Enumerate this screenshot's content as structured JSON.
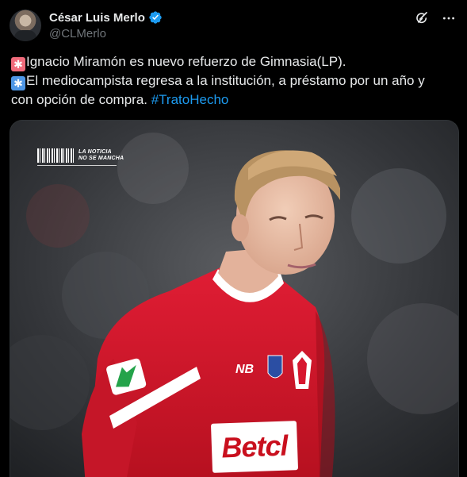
{
  "author": {
    "display_name": "César Luis Merlo",
    "handle": "@CLMerlo",
    "verified": true
  },
  "header_icons": [
    "grok-icon",
    "more-icon"
  ],
  "tweet": {
    "line1": {
      "emoji": "🚨",
      "text": "Ignacio Miramón es nuevo refuerzo de Gimnasia(LP)."
    },
    "line2": {
      "emoji": "✳️",
      "text": "El mediocampista regresa a la institución, a préstamo por un año y"
    },
    "line3": {
      "text": "con opción de compra. ",
      "hashtag": "#TratoHecho"
    }
  },
  "media": {
    "watermark_line1": "LA NOTICIA",
    "watermark_line2": "NO SE MANCHA",
    "sponsor_text": "Betcl"
  },
  "colors": {
    "background": "#000000",
    "text": "#e7e9ea",
    "secondary": "#71767b",
    "link": "#1d9bf0",
    "verified": "#1d9bf0",
    "jersey": "#d7172f"
  }
}
